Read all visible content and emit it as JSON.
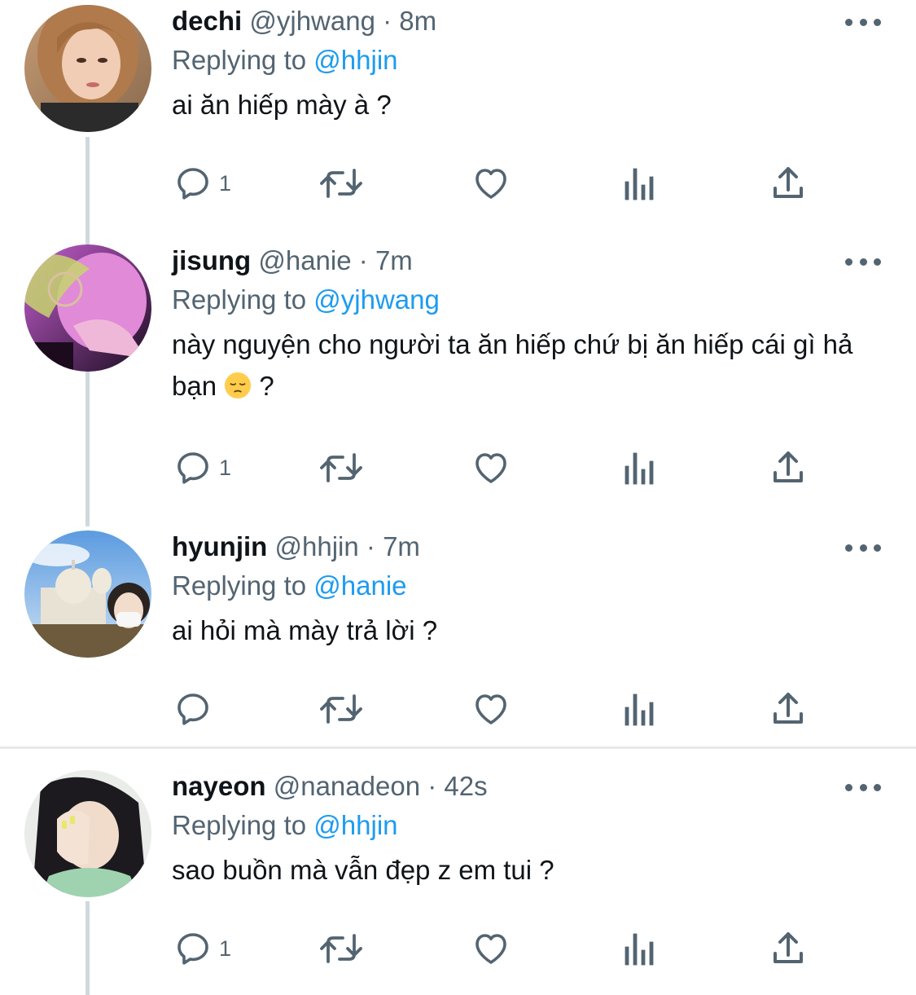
{
  "tweets": [
    {
      "name": "dechi",
      "handle": "@yjhwang",
      "dot": "·",
      "time": "8m",
      "replying_prefix": "Replying to",
      "replying_to": "@hhjin",
      "text": "ai ăn hiếp mày à ?",
      "text_suffix": "",
      "reply_count": "1"
    },
    {
      "name": "jisung",
      "handle": "@hanie",
      "dot": "·",
      "time": "7m",
      "replying_prefix": "Replying to",
      "replying_to": "@yjhwang",
      "text": "này nguyện cho người ta ăn hiếp chứ bị ăn hiếp cái gì hả bạn",
      "text_suffix": " ?",
      "emoji": "pensive-face-emoji",
      "reply_count": "1"
    },
    {
      "name": "hyunjin",
      "handle": "@hhjin",
      "dot": "·",
      "time": "7m",
      "replying_prefix": "Replying to",
      "replying_to": "@hanie",
      "text": "ai hỏi mà mày trả lời ?",
      "text_suffix": "",
      "reply_count": ""
    },
    {
      "name": "nayeon",
      "handle": "@nanadeon",
      "dot": "·",
      "time": "42s",
      "replying_prefix": "Replying to",
      "replying_to": "@hhjin",
      "text": "sao buồn mà vẫn đẹp z em tui ?",
      "text_suffix": "",
      "reply_count": "1"
    }
  ],
  "icons": {
    "reply": "reply-icon",
    "retweet": "retweet-icon",
    "like": "like-icon",
    "views": "views-icon",
    "share": "share-icon",
    "more": "more-icon"
  },
  "colors": {
    "text": "#0f1419",
    "secondary": "#536471",
    "link": "#1d9bf0",
    "thread_line": "#cfd9de",
    "separator": "#e7e9ea"
  }
}
